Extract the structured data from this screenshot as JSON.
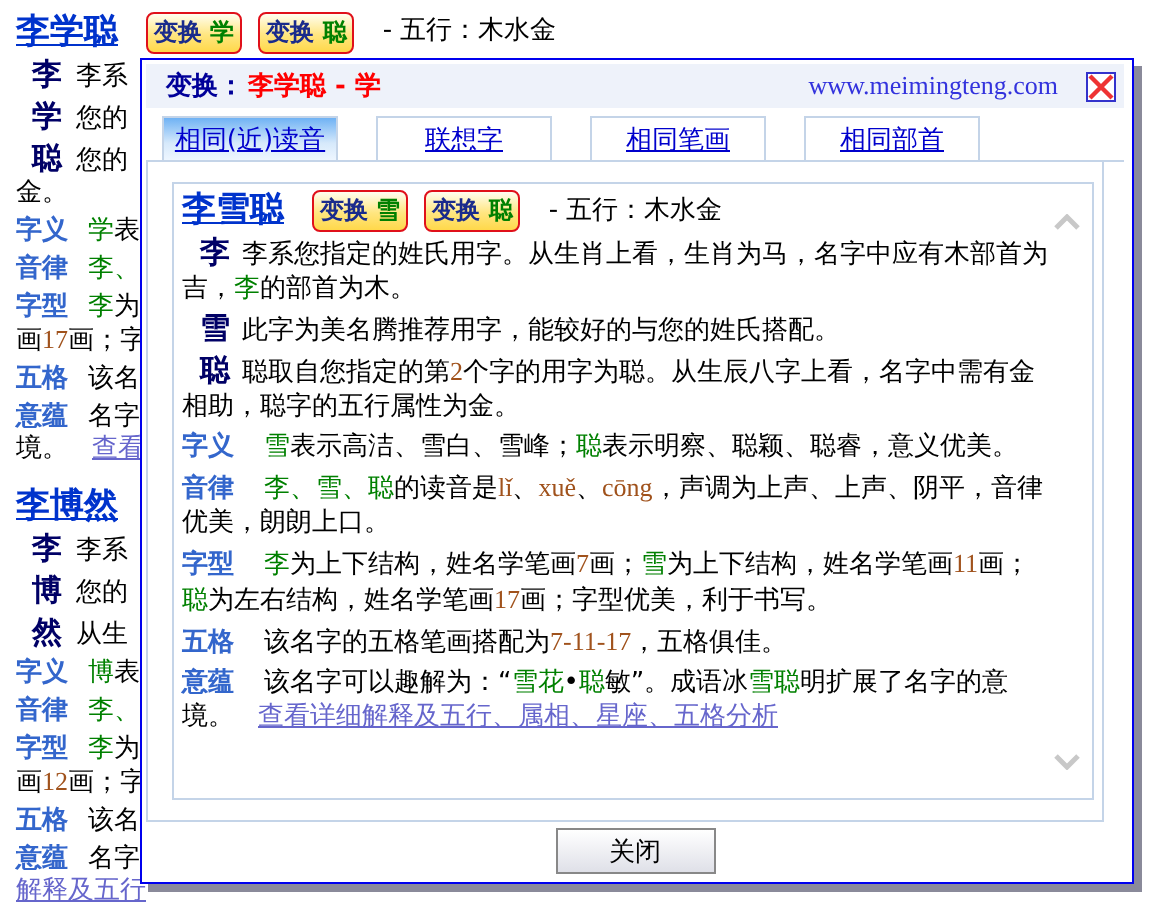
{
  "page": {
    "blocks": [
      {
        "name": "李学聪",
        "buttons": [
          {
            "label": "变换",
            "char": "学"
          },
          {
            "label": "变换",
            "char": "聪"
          }
        ],
        "wuxing": "- 五行：木水金",
        "chars": [
          {
            "char": "李",
            "segs": [
              {
                "t": "李系",
                "kind": "plain"
              }
            ]
          },
          {
            "char": "学",
            "segs": [
              {
                "t": "您的",
                "kind": "plain"
              }
            ]
          },
          {
            "char": "聪",
            "segs": [
              {
                "t": "您的",
                "kind": "plain"
              }
            ],
            "tail": [
              {
                "t": "金。",
                "kind": "plain"
              }
            ]
          }
        ],
        "sections": [
          {
            "label": "字义",
            "segs": [
              {
                "t": "学",
                "kind": "hl"
              },
              {
                "t": "表",
                "kind": "plain"
              }
            ]
          },
          {
            "label": "音律",
            "segs": [
              {
                "t": "李、",
                "kind": "hl"
              }
            ]
          },
          {
            "label": "字型",
            "segs": [
              {
                "t": "李",
                "kind": "hl"
              },
              {
                "t": "为",
                "kind": "plain"
              }
            ],
            "tail": [
              {
                "t": "画",
                "kind": "plain"
              },
              {
                "t": "17",
                "kind": "num"
              },
              {
                "t": "画；字",
                "kind": "plain"
              }
            ]
          },
          {
            "label": "五格",
            "segs": [
              {
                "t": "该名",
                "kind": "plain"
              }
            ]
          },
          {
            "label": "意蕴",
            "segs": [
              {
                "t": "名字",
                "kind": "plain"
              }
            ],
            "tail": [
              {
                "t": "境。",
                "kind": "plain"
              }
            ]
          }
        ],
        "link": "查看"
      },
      {
        "name": "李博然",
        "chars": [
          {
            "char": "李",
            "segs": [
              {
                "t": "李系",
                "kind": "plain"
              }
            ]
          },
          {
            "char": "博",
            "segs": [
              {
                "t": "您的",
                "kind": "plain"
              }
            ]
          },
          {
            "char": "然",
            "segs": [
              {
                "t": "从生",
                "kind": "plain"
              }
            ]
          }
        ],
        "sections": [
          {
            "label": "字义",
            "segs": [
              {
                "t": "博",
                "kind": "hl"
              },
              {
                "t": "表",
                "kind": "plain"
              }
            ]
          },
          {
            "label": "音律",
            "segs": [
              {
                "t": "李、",
                "kind": "hl"
              }
            ]
          },
          {
            "label": "字型",
            "segs": [
              {
                "t": "李",
                "kind": "hl"
              },
              {
                "t": "为",
                "kind": "plain"
              }
            ],
            "tail": [
              {
                "t": "画",
                "kind": "plain"
              },
              {
                "t": "12",
                "kind": "num"
              },
              {
                "t": "画；字",
                "kind": "plain"
              }
            ]
          },
          {
            "label": "五格",
            "segs": [
              {
                "t": "该名",
                "kind": "plain"
              }
            ]
          },
          {
            "label": "意蕴",
            "segs": [
              {
                "t": "名字",
                "kind": "plain"
              }
            ]
          }
        ],
        "link": "解释及五行"
      }
    ]
  },
  "popup": {
    "title_label": "变换：",
    "title_value": "李学聪 - 学",
    "site": "www.meimingteng.com",
    "tabs": [
      {
        "label": "相同(近)读音",
        "selected": true
      },
      {
        "label": "联想字",
        "selected": false
      },
      {
        "label": "相同笔画",
        "selected": false
      },
      {
        "label": "相同部首",
        "selected": false
      }
    ],
    "block": {
      "name": "李雪聪",
      "buttons": [
        {
          "label": "变换",
          "char": "雪"
        },
        {
          "label": "变换",
          "char": "聪"
        }
      ],
      "wuxing": "- 五行：木水金",
      "chars": [
        {
          "char": "李",
          "segs": [
            {
              "t": "李系您指定的姓氏用字。从生肖上看，生肖为马，名字中应有木部首为吉，",
              "kind": "plain"
            },
            {
              "t": "李",
              "kind": "hl"
            },
            {
              "t": "的部首为木。",
              "kind": "plain"
            }
          ]
        },
        {
          "char": "雪",
          "segs": [
            {
              "t": "此字为美名腾推荐用字，能较好的与您的姓氏搭配。",
              "kind": "plain"
            }
          ]
        },
        {
          "char": "聪",
          "segs": [
            {
              "t": "聪取自您指定的第",
              "kind": "plain"
            },
            {
              "t": "2",
              "kind": "num"
            },
            {
              "t": "个字的用字为聪。从生辰八字上看，名字中需有金相助，聪字的五行属性为金。",
              "kind": "plain"
            }
          ]
        }
      ],
      "sections": [
        {
          "label": "字义",
          "segs": [
            {
              "t": "雪",
              "kind": "hl"
            },
            {
              "t": "表示高洁、雪白、雪峰；",
              "kind": "plain"
            },
            {
              "t": "聪",
              "kind": "hl"
            },
            {
              "t": "表示明察、聪颖、聪睿，意义优美。",
              "kind": "plain"
            }
          ]
        },
        {
          "label": "音律",
          "segs": [
            {
              "t": "李、雪、聪",
              "kind": "hl"
            },
            {
              "t": "的读音是",
              "kind": "plain"
            },
            {
              "t": "lǐ",
              "kind": "num"
            },
            {
              "t": "、",
              "kind": "plain"
            },
            {
              "t": "xuě",
              "kind": "num"
            },
            {
              "t": "、",
              "kind": "plain"
            },
            {
              "t": "cōng",
              "kind": "num"
            },
            {
              "t": "，声调为上声、上声、阴平，音律优美，朗朗上口。",
              "kind": "plain"
            }
          ]
        },
        {
          "label": "字型",
          "segs": [
            {
              "t": "李",
              "kind": "hl"
            },
            {
              "t": "为上下结构，姓名学笔画",
              "kind": "plain"
            },
            {
              "t": "7",
              "kind": "num"
            },
            {
              "t": "画；",
              "kind": "plain"
            },
            {
              "t": "雪",
              "kind": "hl"
            },
            {
              "t": "为上下结构，姓名学笔画",
              "kind": "plain"
            },
            {
              "t": "11",
              "kind": "num"
            },
            {
              "t": "画；",
              "kind": "plain"
            },
            {
              "t": "聪",
              "kind": "hl"
            },
            {
              "t": "为左右结构，姓名学笔画",
              "kind": "plain"
            },
            {
              "t": "17",
              "kind": "num"
            },
            {
              "t": "画；字型优美，利于书写。",
              "kind": "plain"
            }
          ]
        },
        {
          "label": "五格",
          "segs": [
            {
              "t": "该名字的五格笔画搭配为",
              "kind": "plain"
            },
            {
              "t": "7-11-17",
              "kind": "num"
            },
            {
              "t": "，五格俱佳。",
              "kind": "plain"
            }
          ]
        },
        {
          "label": "意蕴",
          "segs": [
            {
              "t": "该名字可以趣解为：“",
              "kind": "plain"
            },
            {
              "t": "雪花",
              "kind": "hl"
            },
            {
              "t": "•",
              "kind": "plain"
            },
            {
              "t": "聪",
              "kind": "hl"
            },
            {
              "t": "敏”。成语冰",
              "kind": "plain"
            },
            {
              "t": "雪聪",
              "kind": "hl"
            },
            {
              "t": "明扩展了名字的意",
              "kind": "plain"
            }
          ],
          "tail": [
            {
              "t": "境。",
              "kind": "plain"
            }
          ]
        }
      ],
      "link": "查看详细解释及五行、属相、星座、五格分析"
    },
    "close_button": "关闭"
  }
}
